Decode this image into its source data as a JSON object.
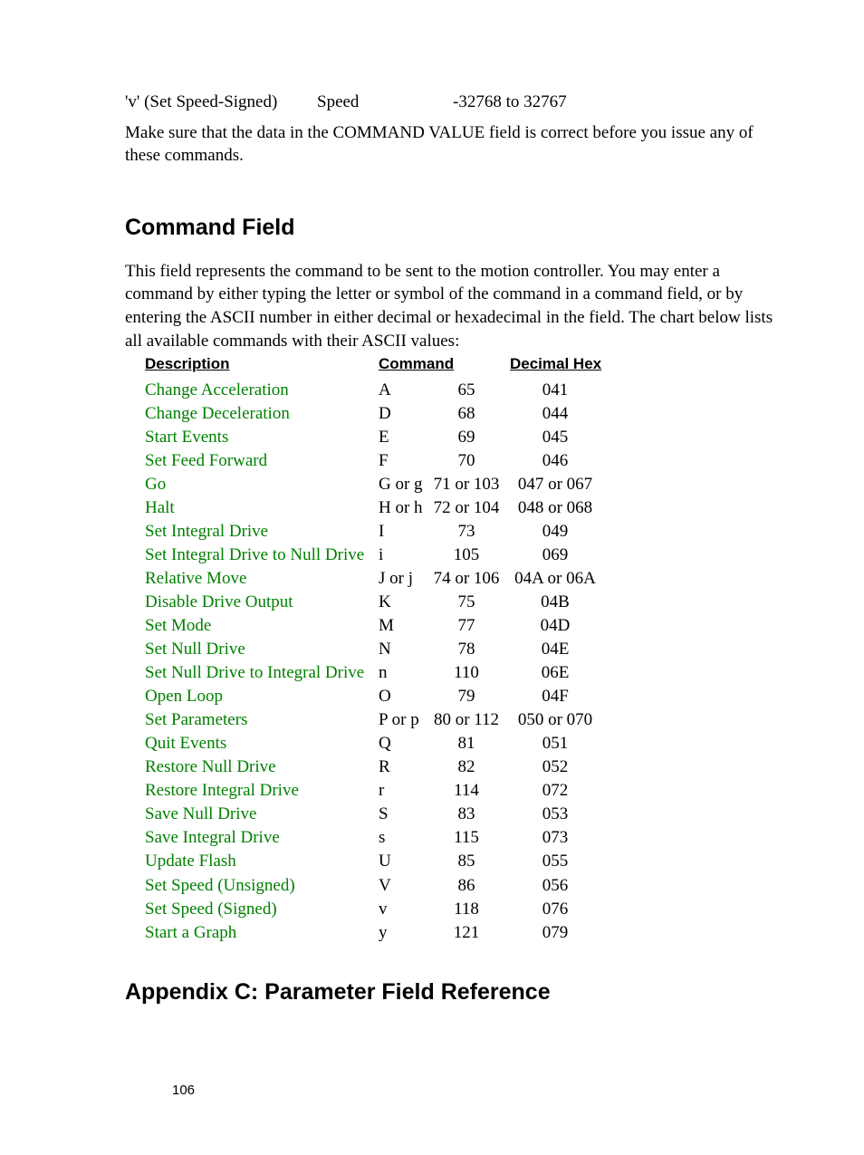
{
  "top_row": {
    "c1": "'v' (Set Speed-Signed)",
    "c2": "Speed",
    "c3": "-32768 to 32767"
  },
  "paragraph1": "Make sure that the data in the COMMAND VALUE field is correct before you issue any of these commands.",
  "heading_command_field": "Command Field",
  "paragraph2": "This field represents the command to be sent to the motion controller.  You may enter a command by either typing the letter or symbol of the command in a command field, or by entering the ASCII number in either decimal or hexadecimal in the field.  The chart below lists all available commands with their ASCII values:",
  "table_headers": {
    "desc": "Description",
    "cmd": "Command",
    "dechex": "Decimal Hex"
  },
  "rows": [
    {
      "desc": "Change Acceleration",
      "cmd": "A",
      "dec": "65",
      "hex": "041"
    },
    {
      "desc": "Change Deceleration",
      "cmd": "D",
      "dec": "68",
      "hex": "044"
    },
    {
      "desc": "Start Events",
      "cmd": "E",
      "dec": "69",
      "hex": "045"
    },
    {
      "desc": "Set Feed Forward",
      "cmd": "F",
      "dec": "70",
      "hex": "046"
    },
    {
      "desc": "Go",
      "cmd": "G or g",
      "dec": "71 or 103",
      "hex": "047 or 067"
    },
    {
      "desc": "Halt",
      "cmd": "H or h",
      "dec": "72 or 104",
      "hex": "048 or 068"
    },
    {
      "desc": "Set Integral Drive",
      "cmd": "I",
      "dec": "73",
      "hex": "049"
    },
    {
      "desc": "Set Integral Drive to Null Drive",
      "cmd": "i",
      "dec": "105",
      "hex": "069"
    },
    {
      "desc": "Relative Move",
      "cmd": "J or j",
      "dec": "74 or 106",
      "hex": "04A or 06A"
    },
    {
      "desc": "Disable Drive Output",
      "cmd": "K",
      "dec": "75",
      "hex": "04B"
    },
    {
      "desc": "Set Mode",
      "cmd": "M",
      "dec": "77",
      "hex": "04D"
    },
    {
      "desc": "Set Null Drive",
      "cmd": "N",
      "dec": "78",
      "hex": "04E"
    },
    {
      "desc": "Set Null Drive to Integral Drive",
      "cmd": "n",
      "dec": "110",
      "hex": "06E"
    },
    {
      "desc": "Open Loop",
      "cmd": "O",
      "dec": "79",
      "hex": "04F"
    },
    {
      "desc": "Set Parameters",
      "cmd": "P or p",
      "dec": "80 or 112",
      "hex": "050 or 070"
    },
    {
      "desc": "Quit Events",
      "cmd": "Q",
      "dec": "81",
      "hex": "051"
    },
    {
      "desc": "Restore Null Drive",
      "cmd": "R",
      "dec": "82",
      "hex": "052"
    },
    {
      "desc": "Restore Integral Drive",
      "cmd": "r",
      "dec": "114",
      "hex": "072"
    },
    {
      "desc": "Save Null Drive",
      "cmd": "S",
      "dec": "83",
      "hex": "053"
    },
    {
      "desc": "Save Integral Drive",
      "cmd": "s",
      "dec": "115",
      "hex": "073"
    },
    {
      "desc": "Update Flash",
      "cmd": "U",
      "dec": "85",
      "hex": "055"
    },
    {
      "desc": "Set Speed (Unsigned)",
      "cmd": "V",
      "dec": "86",
      "hex": "056"
    },
    {
      "desc": "Set Speed (Signed)",
      "cmd": "v",
      "dec": "118",
      "hex": "076"
    },
    {
      "desc": "Start a Graph",
      "cmd": "y",
      "dec": "121",
      "hex": "079"
    }
  ],
  "heading_appendix": "Appendix C: Parameter Field Reference",
  "page_number": "106"
}
